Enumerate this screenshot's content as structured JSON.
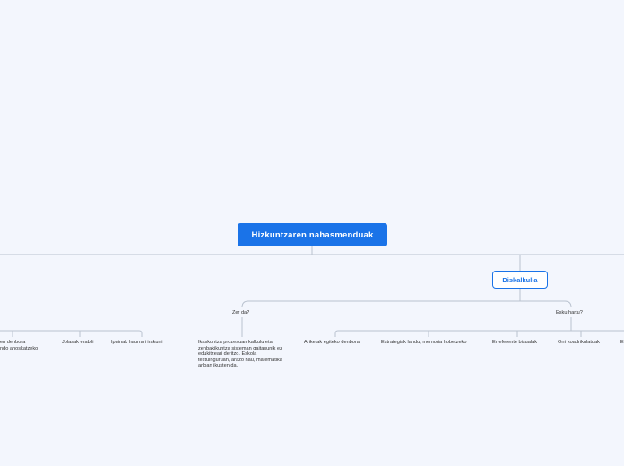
{
  "root": {
    "label": "Hizkuntzaren nahasmenduak"
  },
  "main_topic": {
    "label": "Diskalkulia"
  },
  "subtopics": {
    "what": {
      "label": "Zer da?"
    },
    "how": {
      "label": "Esku hartu?"
    }
  },
  "definition": "Ikaskuntza prozesuan kalkulu eta zenbakikuntza sisteman gaitasunik ez edukitzeari deritzo. Eskola testuinguruan, arazo hau, matematika arloan ikusten da.",
  "left_branch_items": [
    "en denbora",
    "ndo ahoskatzeko",
    "Jolasak erabili",
    "Ipuinak haurrari irakurri"
  ],
  "interventions": [
    "Ariketak egiteko denbora",
    "Estrategiak landu, memoria hobetzeko",
    "Erreferente bisualak",
    "Orri koadrikulatuak",
    "E"
  ],
  "colors": {
    "accent": "#1a73e8",
    "line": "#b9c2cf",
    "background": "#f3f6fd"
  }
}
